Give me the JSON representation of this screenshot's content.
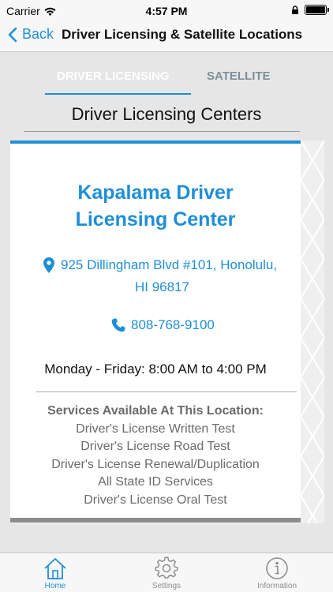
{
  "status_bar": {
    "carrier": "Carrier",
    "time": "4:57 PM",
    "battery_level": 1.0
  },
  "nav": {
    "back_label": "Back",
    "title": "Driver Licensing & Satellite Locations"
  },
  "tabs": [
    {
      "label": "DRIVER LICENSING",
      "active": true
    },
    {
      "label": "SATELLITE",
      "active": false
    }
  ],
  "section_title": "Driver Licensing Centers",
  "location": {
    "name_line1": "Kapalama Driver",
    "name_line2": "Licensing Center",
    "address_line1": "925 Dillingham Blvd #101, Honolulu,",
    "address_line2": "HI 96817",
    "phone": "808-768-9100",
    "hours": "Monday - Friday: 8:00 AM to 4:00 PM",
    "services_heading": "Services Available At This Location:",
    "services": [
      "Driver's License Written Test",
      "Driver's License Road Test",
      "Driver's License Renewal/Duplication",
      "All State ID Services",
      "Driver's License Oral Test"
    ]
  },
  "tab_bar": [
    {
      "label": "Home",
      "icon": "home-icon",
      "selected": true
    },
    {
      "label": "Settings",
      "icon": "gear-icon",
      "selected": false
    },
    {
      "label": "Information",
      "icon": "info-icon",
      "selected": false
    }
  ],
  "colors": {
    "accent": "#1e8fd6",
    "background": "#e6e6e6",
    "inactive_tab": "#7d8f99",
    "service_text": "#6b6b6b"
  }
}
